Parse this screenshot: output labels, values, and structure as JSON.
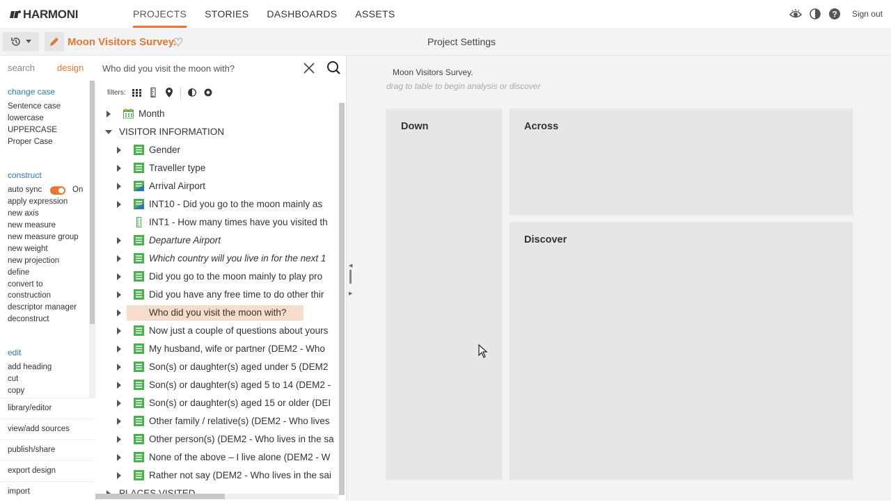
{
  "app": {
    "logo_text": "HARMONI",
    "nav": [
      "PROJECTS",
      "STORIES",
      "DASHBOARDS",
      "ASSETS"
    ],
    "active_nav": "PROJECTS",
    "sign_out": "Sign out"
  },
  "project": {
    "name": "Moon Visitors Survey.",
    "settings_title": "Project Settings"
  },
  "left_panel": {
    "tabs": {
      "search": "search",
      "design": "design"
    },
    "change_case": {
      "title": "change case",
      "items": [
        "Sentence case",
        "lowercase",
        "UPPERCASE",
        "Proper Case"
      ]
    },
    "construct": {
      "title": "construct",
      "auto_sync_label": "auto sync",
      "auto_sync_state": "On",
      "items": [
        "apply expression",
        "new axis",
        "new measure",
        "new measure group",
        "new weight",
        "new projection",
        "define",
        "convert to",
        "construction",
        "descriptor manager",
        "deconstruct"
      ]
    },
    "edit": {
      "title": "edit",
      "items": [
        "add heading",
        "cut",
        "copy"
      ]
    },
    "lower_items": [
      "library/editor",
      "view/add sources",
      "publish/share",
      "export design",
      "import"
    ]
  },
  "search": {
    "value": "Who did you visit the moon with?",
    "filters_label": "filters:"
  },
  "tree": {
    "rows": [
      {
        "label": "Month",
        "level": 0,
        "icon": "calendar-icon",
        "caret": "right"
      },
      {
        "label": "VISITOR INFORMATION",
        "level": 0,
        "icon": "none",
        "caret": "down"
      },
      {
        "label": "Gender",
        "level": 1,
        "icon": "list-icon",
        "caret": "right"
      },
      {
        "label": "Traveller type",
        "level": 1,
        "icon": "list-icon",
        "caret": "right"
      },
      {
        "label": "Arrival Airport",
        "level": 1,
        "icon": "list-map-icon",
        "caret": "right"
      },
      {
        "label": "INT10 - Did you go to the moon mainly as",
        "level": 1,
        "icon": "list-map-icon",
        "caret": "right"
      },
      {
        "label": "INT1 - How many times have you visited th",
        "level": 1,
        "icon": "ruler-icon",
        "caret": "none"
      },
      {
        "label": "Departure Airport",
        "level": 1,
        "icon": "list-icon",
        "caret": "right",
        "italic": true
      },
      {
        "label": "Which country will you live in for the next 1",
        "level": 1,
        "icon": "list-icon",
        "caret": "right",
        "italic": true
      },
      {
        "label": "Did you go to the moon mainly to play pro",
        "level": 1,
        "icon": "list-icon",
        "caret": "right"
      },
      {
        "label": "Did you have any free time to do other thir",
        "level": 1,
        "icon": "list-icon",
        "caret": "right"
      },
      {
        "label": "Who did you visit the moon with?",
        "level": 1,
        "icon": "list-icon",
        "caret": "right",
        "highlight": true
      },
      {
        "label": "Now just a couple of questions about yours",
        "level": 1,
        "icon": "list-icon",
        "caret": "right"
      },
      {
        "label": "My husband, wife or partner (DEM2 - Who",
        "level": 1,
        "icon": "list-icon",
        "caret": "right"
      },
      {
        "label": "Son(s) or daughter(s) aged under 5 (DEM2",
        "level": 1,
        "icon": "list-icon",
        "caret": "right"
      },
      {
        "label": "Son(s) or daughter(s) aged 5 to 14 (DEM2 -",
        "level": 1,
        "icon": "list-icon",
        "caret": "right"
      },
      {
        "label": "Son(s) or daughter(s) aged 15 or older (DEI",
        "level": 1,
        "icon": "list-icon",
        "caret": "right"
      },
      {
        "label": "Other family / relative(s) (DEM2 - Who lives",
        "level": 1,
        "icon": "list-icon",
        "caret": "right"
      },
      {
        "label": "Other person(s) (DEM2 - Who lives in the sa",
        "level": 1,
        "icon": "list-icon",
        "caret": "right"
      },
      {
        "label": "None of the above – I live alone (DEM2 - W",
        "level": 1,
        "icon": "list-icon",
        "caret": "right"
      },
      {
        "label": "Rather not say (DEM2 - Who lives in the sai",
        "level": 1,
        "icon": "list-icon",
        "caret": "right"
      },
      {
        "label": "PLACES VISITED",
        "level": 0,
        "icon": "none",
        "caret": "right"
      }
    ]
  },
  "canvas": {
    "survey_label": "Moon Visitors Survey.",
    "drag_hint": "drag to table to begin analysis or discover",
    "down_title": "Down",
    "across_title": "Across",
    "discover_title": "Discover"
  },
  "colors": {
    "accent": "#e87632",
    "link": "#2a79b8",
    "icon_green": "#4caf50",
    "highlight": "#f6dccb"
  }
}
